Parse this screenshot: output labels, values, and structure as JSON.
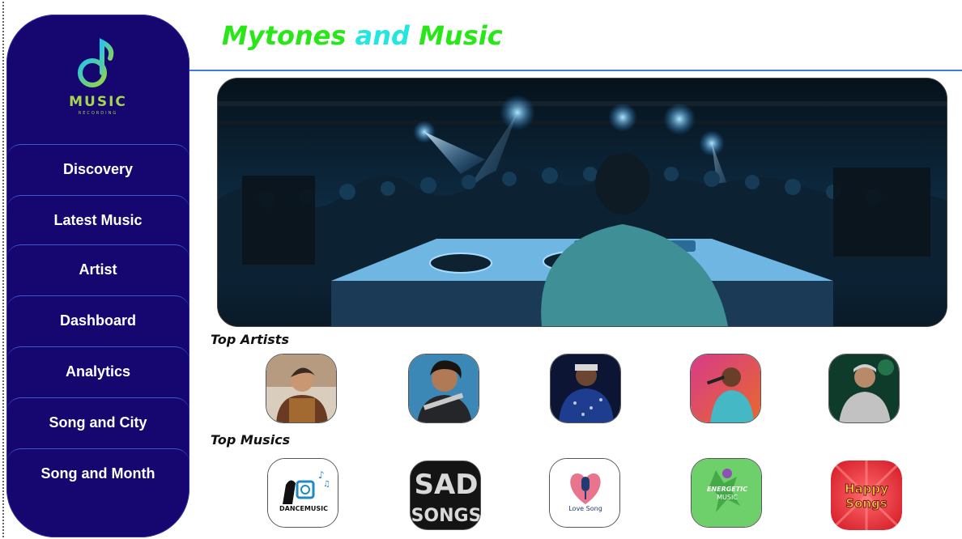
{
  "app": {
    "logo": {
      "text": "MUSIC",
      "subtext": "RECORDING"
    },
    "title": {
      "part1": "Mytones",
      "part2": "and",
      "part3": "Music"
    }
  },
  "sidebar": {
    "items": [
      {
        "label": "Discovery"
      },
      {
        "label": "Latest Music"
      },
      {
        "label": "Artist"
      },
      {
        "label": "Dashboard"
      },
      {
        "label": "Analytics"
      },
      {
        "label": "Song and City"
      },
      {
        "label": "Song and Month"
      }
    ]
  },
  "sections": {
    "top_artists": {
      "title": "Top Artists"
    },
    "top_musics": {
      "title": "Top Musics",
      "items": [
        {
          "name": "dance-music",
          "label": "DANCEMUSIC"
        },
        {
          "name": "sad-songs",
          "label_line1": "SAD",
          "label_line2": "SONGS"
        },
        {
          "name": "love-song",
          "label": "Love Song"
        },
        {
          "name": "energetic-music",
          "label_line1": "ENERGETIC",
          "label_line2": "MUSIC"
        },
        {
          "name": "happy-songs",
          "label_line1": "Happy",
          "label_line2": "Songs"
        }
      ]
    }
  },
  "colors": {
    "sidebar_bg": "#150670",
    "title_green": "#27e816",
    "title_cyan": "#22e6e0",
    "divider_blue": "#3b7fd6"
  }
}
